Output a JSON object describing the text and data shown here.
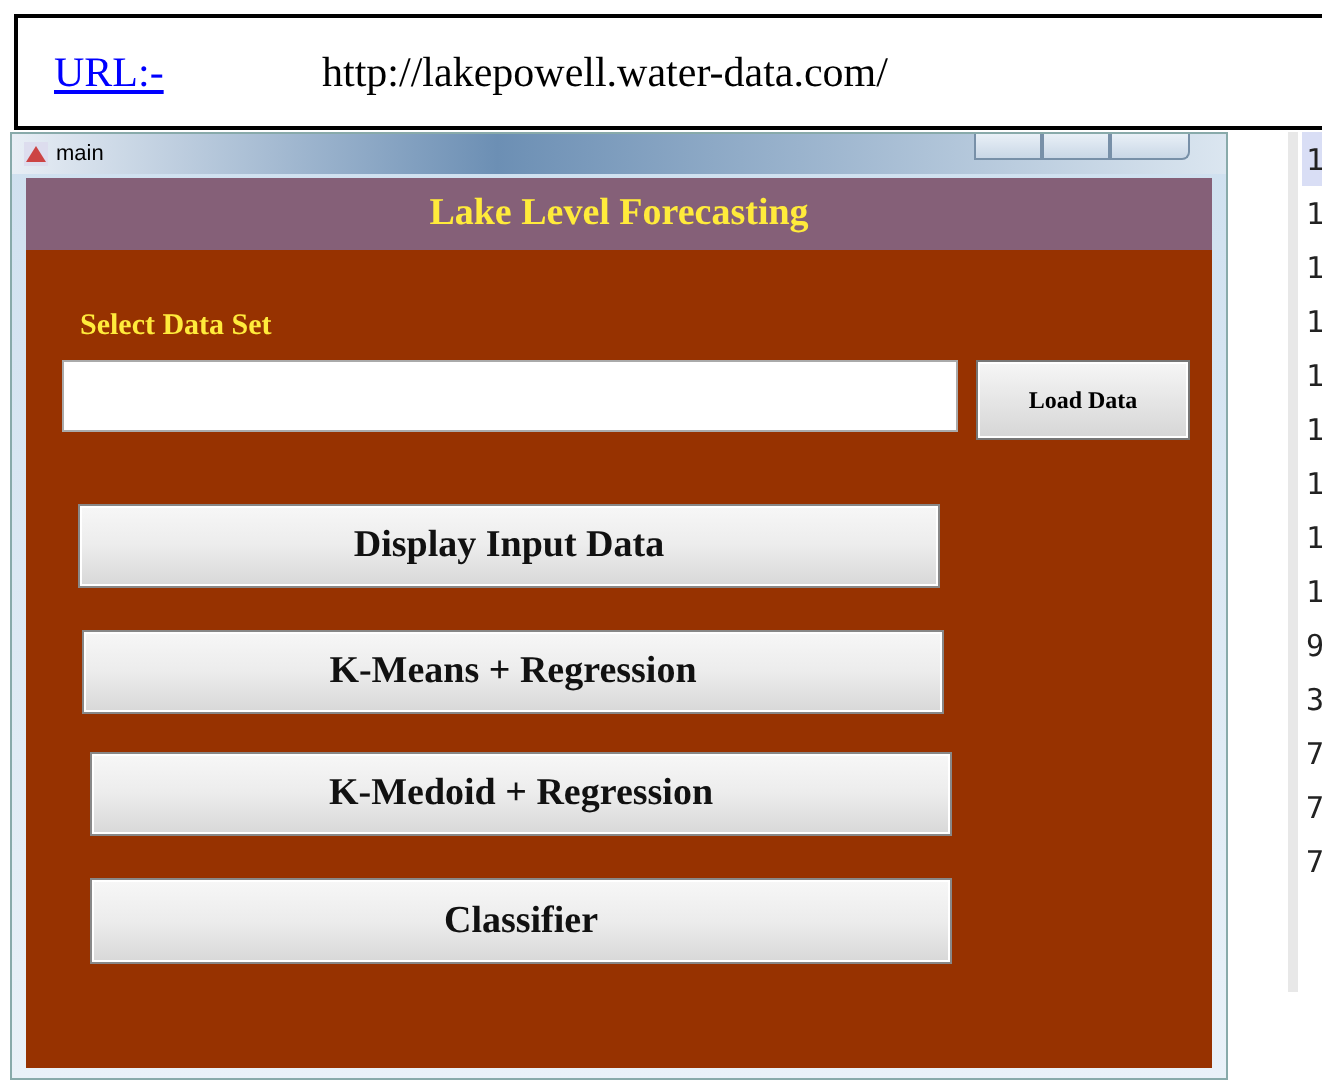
{
  "url_note": {
    "label": "URL:-",
    "url": "http://lakepowell.water-data.com/"
  },
  "window": {
    "title": "main"
  },
  "app": {
    "header": "Lake Level Forecasting",
    "select_label": "Select Data Set",
    "load_button": "Load Data",
    "buttons": [
      "Display Input Data",
      "K-Means + Regression",
      "K-Medoid + Regression",
      "Classifier"
    ]
  },
  "side_list": [
    {
      "text": "1",
      "selected": true
    },
    {
      "text": "1",
      "selected": false
    },
    {
      "text": "1",
      "selected": false
    },
    {
      "text": "1",
      "selected": false
    },
    {
      "text": "1",
      "selected": false
    },
    {
      "text": "1",
      "selected": false
    },
    {
      "text": "1",
      "selected": false
    },
    {
      "text": "1",
      "selected": false
    },
    {
      "text": "1",
      "selected": false
    },
    {
      "text": "9",
      "selected": false
    },
    {
      "text": "3",
      "selected": false
    },
    {
      "text": "7",
      "selected": false
    },
    {
      "text": "7",
      "selected": false
    },
    {
      "text": "7",
      "selected": false
    }
  ]
}
